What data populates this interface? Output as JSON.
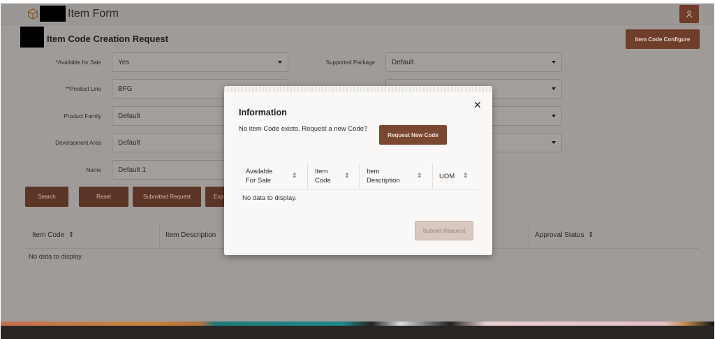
{
  "header": {
    "app_title": "Item Form",
    "logo_icon": "cube-icon",
    "user_icon": "user-icon"
  },
  "page": {
    "title": "Item Code Creation Request",
    "configure_label": "Item Code Configure"
  },
  "form": {
    "left": [
      {
        "label": "*Available for Sale",
        "value": "Yes"
      },
      {
        "label": "**Product Line",
        "value": "BFG"
      },
      {
        "label": "Product Family",
        "value": "Default"
      },
      {
        "label": "Development Area",
        "value": "Default"
      },
      {
        "label": "Name",
        "value": "Default 1"
      }
    ],
    "right": [
      {
        "label": "Supported Package",
        "value": "Default"
      },
      {
        "label": "",
        "value": ""
      },
      {
        "label": "",
        "value": ""
      },
      {
        "label": "",
        "value": ""
      }
    ]
  },
  "buttons": {
    "search": "Search",
    "reset": "Reset",
    "submitted": "Submitted Request",
    "export": "Exp"
  },
  "table": {
    "columns": [
      "Item Code",
      "Item Description",
      "Approval Status"
    ],
    "empty": "No data to display."
  },
  "modal": {
    "title": "Information",
    "message": "No item Code exists. Request a new Code?",
    "request_label": "Request New Code",
    "columns": [
      [
        "Available",
        "For Sale"
      ],
      [
        "Item",
        "Code"
      ],
      [
        "Item",
        "Description"
      ],
      [
        "UOM",
        ""
      ]
    ],
    "empty": "No data to display.",
    "submit_label": "Submit Request"
  },
  "colors": {
    "accent": "#6e3e2a",
    "overlay": "#9f9b99",
    "modal_bg": "#f9f8f7"
  }
}
